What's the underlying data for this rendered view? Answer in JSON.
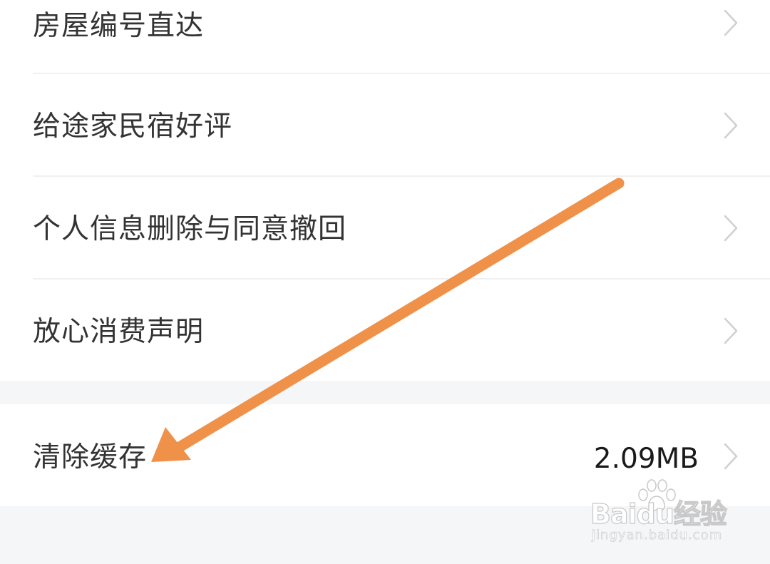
{
  "settings_list": {
    "items": [
      {
        "label": "房屋编号直达",
        "icon": "chevron-right-icon"
      },
      {
        "label": "给途家民宿好评",
        "icon": "chevron-right-icon"
      },
      {
        "label": "个人信息删除与同意撤回",
        "icon": "chevron-right-icon"
      },
      {
        "label": "放心消费声明",
        "icon": "chevron-right-icon"
      }
    ],
    "clear_cache": {
      "label": "清除缓存",
      "value": "2.09MB",
      "icon": "chevron-right-icon"
    }
  },
  "annotation": {
    "icon": "arrow-pointer-icon",
    "color": "#f0914a"
  },
  "watermark": {
    "logo": "Baidu经验",
    "url": "jingyan.baidu.com",
    "icon": "paw-icon"
  },
  "colors": {
    "background": "#f5f6f8",
    "card": "#ffffff",
    "text": "#333333",
    "chevron": "#cfcfcf",
    "divider": "#f0f0f0"
  }
}
